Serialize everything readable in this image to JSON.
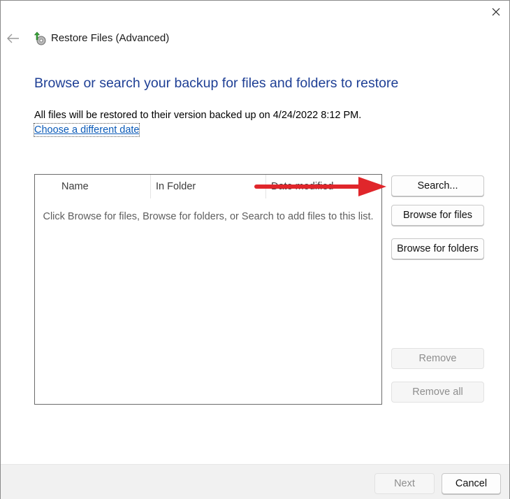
{
  "window": {
    "title": "Restore Files (Advanced)",
    "close_icon": "close-icon",
    "back_icon": "back-arrow-icon",
    "app_icon": "restore-files-icon"
  },
  "main": {
    "heading": "Browse or search your backup for files and folders to restore",
    "restore_info": "All files will be restored to their version backed up on 4/24/2022 8:12 PM.",
    "choose_date_link": "Choose a different date"
  },
  "file_list": {
    "columns": [
      "Name",
      "In Folder",
      "Date modified"
    ],
    "empty_message": "Click Browse for files, Browse for folders, or Search to add files to this list."
  },
  "side_buttons": {
    "search": "Search...",
    "browse_files": "Browse for files",
    "browse_folders": "Browse for folders",
    "remove": "Remove",
    "remove_all": "Remove all"
  },
  "footer": {
    "next": "Next",
    "cancel": "Cancel"
  },
  "annotation": {
    "arrow_color": "#e0262b",
    "arrow_icon": "red-arrow-annotation"
  },
  "colors": {
    "heading": "#1e3f95",
    "link": "#0a5ab8"
  }
}
